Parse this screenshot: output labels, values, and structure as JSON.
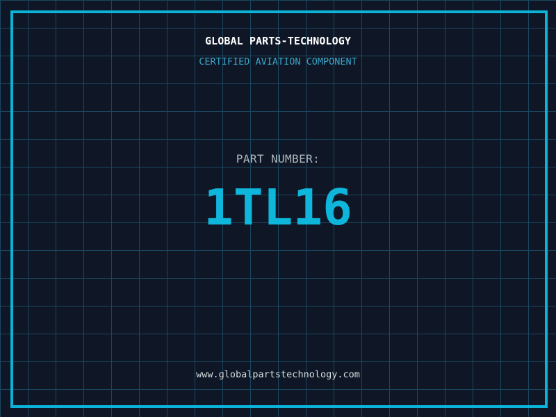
{
  "page": {
    "title": "GLOBAL PARTS-TECHNOLOGY",
    "subtitle": "CERTIFIED AVIATION COMPONENT",
    "part_label": "PART NUMBER:",
    "part_number": "1TL16",
    "website": "www.globalpartstechnology.com"
  },
  "colors": {
    "background": "#0f1726",
    "grid_line": "#1b475f",
    "frame": "#0cb2d8",
    "part_cyan": "#0fb6db",
    "subtitle_cyan": "#3aa6c8",
    "label_gray": "#b0b8be",
    "url_light": "#d6dee0",
    "title_white": "#ffffff"
  }
}
